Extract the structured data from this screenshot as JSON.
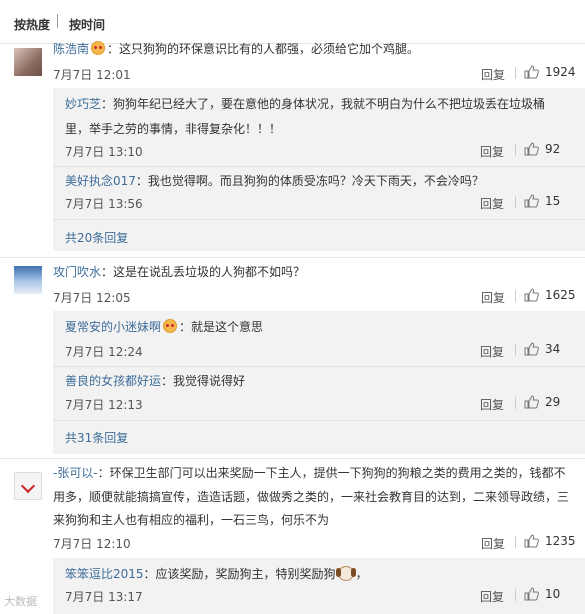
{
  "sort": {
    "hot": "按热度",
    "time": "按时间"
  },
  "comments": [
    {
      "user": "陈浩南",
      "text": "：这只狗狗的环保意识比有的人都强，必须给它加个鸡腿。",
      "time": "7月7日 12:01",
      "reply": "回复",
      "likes": "1924",
      "replies": [
        {
          "user": "妙巧芝",
          "text1": "：狗狗年纪已经大了，要在意他的身体状况，我就不明白为什么不把垃圾丢在垃圾桶",
          "text2": "里，举手之劳的事情，非得复杂化！！！",
          "time": "7月7日 13:10",
          "reply": "回复",
          "likes": "92"
        },
        {
          "user": "美好执念017",
          "text1": "：我也觉得啊。而且狗狗的体质受冻吗？冷天下雨天，不会冷吗？",
          "time": "7月7日 13:56",
          "reply": "回复",
          "likes": "15"
        }
      ],
      "more": "共20条回复"
    },
    {
      "user": "攻门吹水",
      "text": "：这是在说乱丢垃圾的人狗都不如吗？",
      "time": "7月7日 12:05",
      "reply": "回复",
      "likes": "1625",
      "replies": [
        {
          "user": "夏常安的小迷妹啊",
          "text1": "：就是这个意思",
          "time": "7月7日 12:24",
          "reply": "回复",
          "likes": "34"
        },
        {
          "user": "善良的女孩都好运",
          "text1": "：我觉得说得好",
          "time": "7月7日 12:13",
          "reply": "回复",
          "likes": "29"
        }
      ],
      "more": "共31条回复"
    },
    {
      "user": "-张可以-",
      "text1": "：环保卫生部门可以出来奖励一下主人，提供一下狗狗的狗粮之类的费用之类的，钱都不",
      "text2": "用多，顺便就能搞搞宣传，造造话题，做做秀之类的，一来社会教育目的达到，二来领导政绩，三",
      "text3": "来狗狗和主人也有相应的福利，一石三鸟，何乐不为",
      "time": "7月7日 12:10",
      "reply": "回复",
      "likes": "1235",
      "replies": [
        {
          "user": "笨笨逗比2015",
          "text1": "：应该奖励，奖励狗主，特别奖励狗",
          "text1b": "，",
          "time": "7月7日 13:17",
          "reply": "回复",
          "likes": "10"
        }
      ]
    }
  ],
  "watermark": "大数据"
}
